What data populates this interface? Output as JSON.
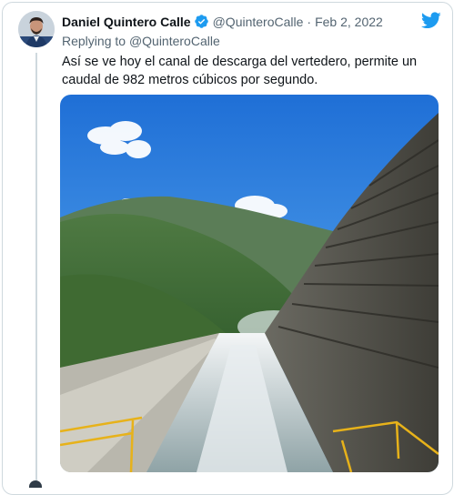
{
  "tweet": {
    "author_name": "Daniel Quintero Calle",
    "handle": "@QuinteroCalle",
    "separator": "·",
    "date": "Feb 2, 2022",
    "reply_prefix": "Replying to",
    "reply_handle": "@QuinteroCalle",
    "text": "Así se ve hoy el canal de descarga del vertedero, permite un caudal de 982 metros cúbicos por segundo."
  },
  "icons": {
    "verified": "verified-badge-icon",
    "logo": "twitter-bird-icon"
  },
  "colors": {
    "brand_blue": "#1d9bf0",
    "text_primary": "#0f1419",
    "text_secondary": "#536471",
    "border": "#cfd9de"
  }
}
